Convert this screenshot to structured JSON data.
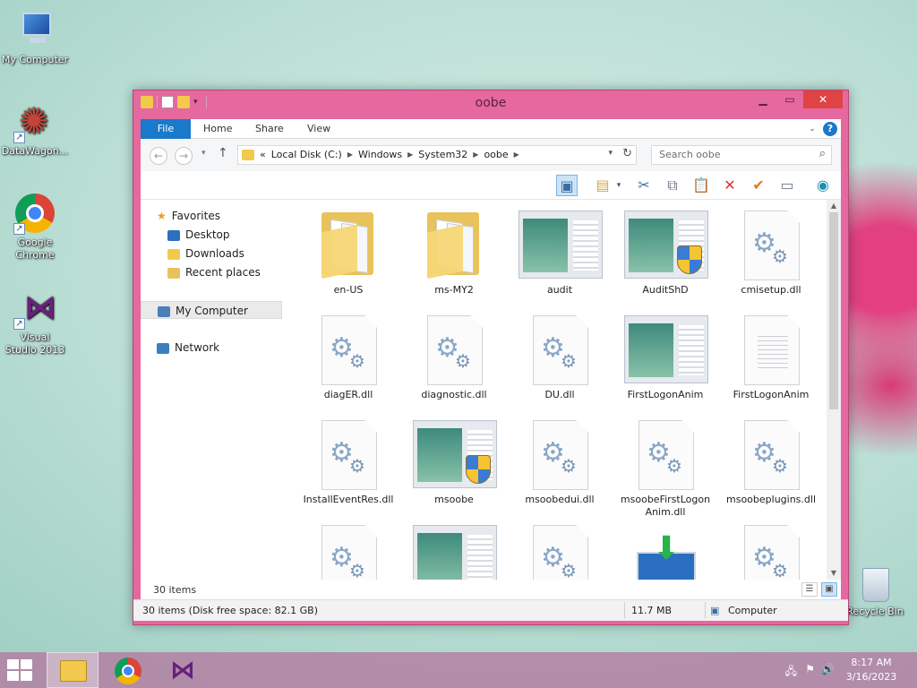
{
  "desktop": {
    "icons": [
      {
        "label": "My Computer",
        "icon": "my-computer-icon"
      },
      {
        "label": "DataWagon...",
        "icon": "datawagon-icon"
      },
      {
        "label": "Google Chrome",
        "icon": "chrome-icon"
      },
      {
        "label": "Visual Studio 2013",
        "icon": "visual-studio-icon"
      },
      {
        "label": "Recycle Bin",
        "icon": "recycle-bin-icon"
      }
    ]
  },
  "window": {
    "title": "oobe",
    "ribbon_tabs": {
      "file": "File",
      "home": "Home",
      "share": "Share",
      "view": "View"
    },
    "address": {
      "prefix": "«",
      "crumbs": [
        "Local Disk (C:)",
        "Windows",
        "System32",
        "oobe"
      ]
    },
    "search_placeholder": "Search oobe",
    "nav": {
      "favorites": "Favorites",
      "desktop": "Desktop",
      "downloads": "Downloads",
      "recent": "Recent places",
      "computer": "My Computer",
      "network": "Network"
    },
    "files": [
      {
        "name": "en-US",
        "type": "folder"
      },
      {
        "name": "ms-MY2",
        "type": "folder"
      },
      {
        "name": "audit",
        "type": "app"
      },
      {
        "name": "AuditShD",
        "type": "app-shield"
      },
      {
        "name": "cmisetup.dll",
        "type": "dll"
      },
      {
        "name": "diagER.dll",
        "type": "dll"
      },
      {
        "name": "diagnostic.dll",
        "type": "dll"
      },
      {
        "name": "DU.dll",
        "type": "dll"
      },
      {
        "name": "FirstLogonAnim",
        "type": "app"
      },
      {
        "name": "FirstLogonAnim",
        "type": "text"
      },
      {
        "name": "InstallEventRes.dll",
        "type": "dll"
      },
      {
        "name": "msoobe",
        "type": "app-shield"
      },
      {
        "name": "msoobedui.dll",
        "type": "dll"
      },
      {
        "name": "msoobeFirstLogonAnim.dll",
        "type": "dll"
      },
      {
        "name": "msoobeplugins.dll",
        "type": "dll"
      },
      {
        "name": "",
        "type": "dll"
      },
      {
        "name": "",
        "type": "app"
      },
      {
        "name": "",
        "type": "dll"
      },
      {
        "name": "",
        "type": "install"
      },
      {
        "name": "",
        "type": "dll"
      }
    ],
    "status_count": "30 items",
    "details": {
      "summary": "30 items (Disk free space: 82.1 GB)",
      "size": "11.7 MB",
      "location": "Computer"
    }
  },
  "taskbar": {
    "time": "8:17 AM",
    "date": "3/16/2023"
  }
}
